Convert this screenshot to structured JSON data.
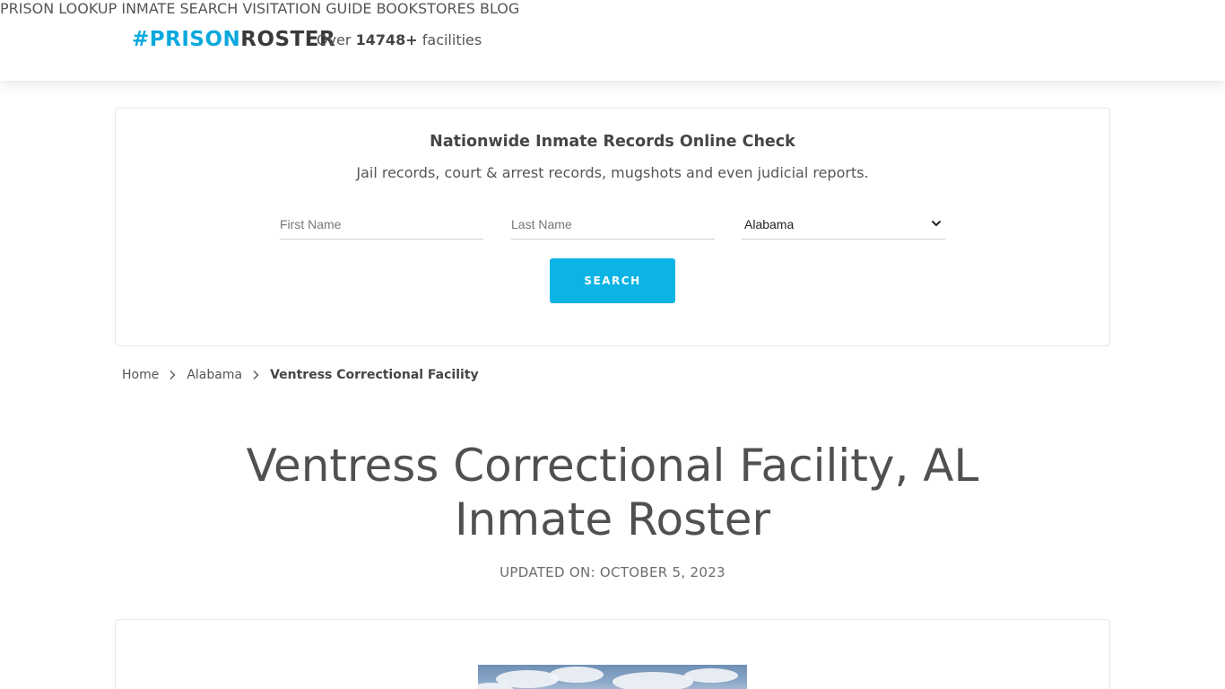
{
  "header": {
    "logo": {
      "hash": "#",
      "prison": "PRISON",
      "roster": "ROSTER"
    },
    "facility_count": {
      "prefix": "Over",
      "count": "14748+",
      "suffix": "facilities"
    },
    "nav": [
      {
        "label": "PRISON LOOKUP"
      },
      {
        "label": "INMATE SEARCH"
      },
      {
        "label": "VISITATION GUIDE"
      },
      {
        "label": "BOOKSTORES"
      },
      {
        "label": "BLOG"
      }
    ]
  },
  "search": {
    "title": "Nationwide Inmate Records Online Check",
    "subtitle": "Jail records, court & arrest records, mugshots and even judicial reports.",
    "first_name_placeholder": "First Name",
    "last_name_placeholder": "Last Name",
    "state_selected": "Alabama",
    "button_label": "SEARCH"
  },
  "breadcrumb": {
    "home": "Home",
    "state": "Alabama",
    "current": "Ventress Correctional Facility"
  },
  "page": {
    "title_line1": "Ventress Correctional Facility, AL",
    "title_line2": "Inmate Roster",
    "updated": "UPDATED ON: OCTOBER 5, 2023"
  },
  "colors": {
    "brand_blue": "#0aa8dd",
    "button_blue": "#0bb4e4",
    "text_gray": "#555555"
  },
  "icons": {
    "select_chevron": "chevron-down-icon",
    "breadcrumb_separator": "chevron-right-icon"
  }
}
